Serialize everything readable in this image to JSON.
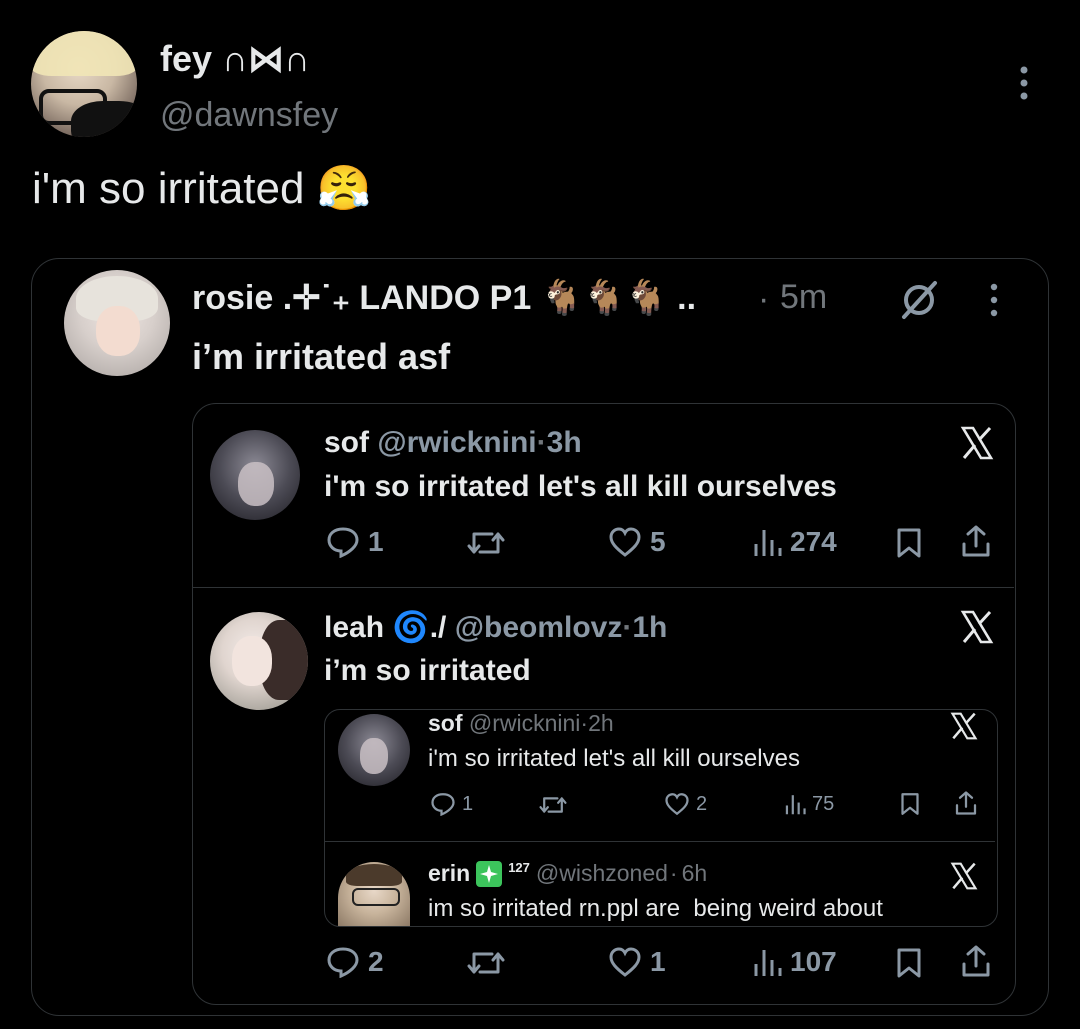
{
  "main_post": {
    "display_name": "fey ∩⋈∩",
    "handle": "@dawnsfey",
    "text": "i'm so irritated",
    "emoji": "😤"
  },
  "quote1": {
    "display_name": "rosie .✛˙₊ LANDO P1 🐐🐐🐐 ..",
    "separator": "·",
    "time": "5m",
    "text": "i’m irritated asf",
    "thread": [
      {
        "display_name": "sof",
        "handle": "@rwicknini",
        "time": "3h",
        "text": "i'm so irritated let's all kill ourselves",
        "replies": "1",
        "likes": "5",
        "views": "274"
      },
      {
        "display_name": "leah 🌀./",
        "handle": "@beomlovz",
        "time": "1h",
        "text": "i’m so irritated",
        "replies": "2",
        "likes": "1",
        "views": "107",
        "nested": [
          {
            "display_name": "sof",
            "handle": "@rwicknini",
            "time": "2h",
            "text": "i'm so irritated let's all kill ourselves",
            "replies": "1",
            "likes": "2",
            "views": "75"
          },
          {
            "display_name": "erin",
            "badge_count": "127",
            "handle": "@wishzoned",
            "time": "6h",
            "text": "im so irritated rn.ppl are  being weird about"
          }
        ]
      }
    ]
  },
  "colors": {
    "background": "#000000",
    "text": "#e7e9ea",
    "muted": "#71767b",
    "border": "#2f3336",
    "badge": "#3cc45c"
  },
  "icons": [
    "more-vertical-icon",
    "x-logo-icon",
    "reply-icon",
    "repost-icon",
    "like-icon",
    "views-icon",
    "bookmark-icon",
    "share-icon",
    "grok-icon"
  ]
}
